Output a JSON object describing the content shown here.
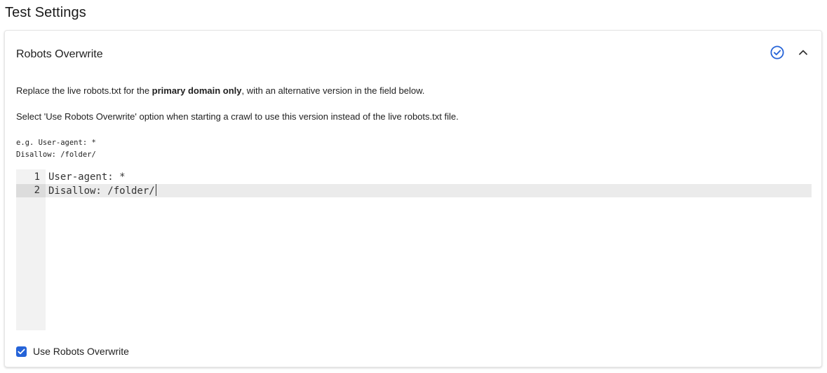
{
  "page": {
    "title": "Test Settings"
  },
  "panel": {
    "title": "Robots Overwrite",
    "status_icon": "check-circle-icon",
    "collapse_icon": "chevron-up-icon",
    "accent_color": "#2563d8"
  },
  "description": {
    "line1_prefix": "Replace the live robots.txt for the ",
    "line1_bold": "primary domain only",
    "line1_suffix": ", with an alternative version in the field below.",
    "line2": "Select 'Use Robots Overwrite' option when starting a crawl to use this version instead of the live robots.txt file."
  },
  "example": {
    "line1": "e.g. User-agent: *",
    "line2": "Disallow: /folder/"
  },
  "editor": {
    "lines": [
      {
        "number": "1",
        "text": "User-agent: *"
      },
      {
        "number": "2",
        "text": "Disallow: /folder/"
      }
    ],
    "active_line": 2
  },
  "option": {
    "label": "Use Robots Overwrite",
    "checked": true
  }
}
